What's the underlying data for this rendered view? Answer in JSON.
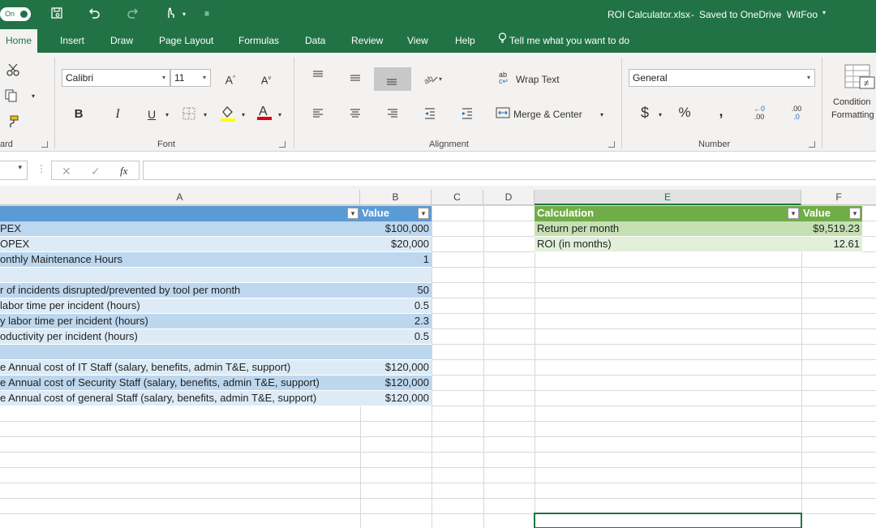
{
  "titlebar": {
    "autosave": "On",
    "document": "ROI Calculator.xlsx",
    "saved": "Saved to OneDrive",
    "account": "WitFoo"
  },
  "tabs": [
    "Home",
    "Insert",
    "Draw",
    "Page Layout",
    "Formulas",
    "Data",
    "Review",
    "View",
    "Help"
  ],
  "tellme": "Tell me what you want to do",
  "ribbon": {
    "groups": {
      "clipboard": "ard",
      "font": "Font",
      "alignment": "Alignment",
      "number": "Number"
    },
    "font_name": "Calibri",
    "font_size": "11",
    "bold": "B",
    "italic": "I",
    "underline": "U",
    "wrap_text": "Wrap Text",
    "merge_center": "Merge & Center",
    "number_format": "General",
    "currency": "$",
    "percent": "%",
    "comma": ",",
    "inc_decimal": ".00",
    "dec_decimal": ".0",
    "conditional_formatting": "Condition",
    "conditional_formatting_2": "Formatting"
  },
  "formula_bar": {
    "fx": "fx",
    "content": ""
  },
  "columns": [
    "A",
    "B",
    "C",
    "D",
    "E",
    "F"
  ],
  "table1": {
    "header_b": "Value",
    "rows": [
      {
        "a": "PEX",
        "b": "$100,000"
      },
      {
        "a": "OPEX",
        "b": "$20,000"
      },
      {
        "a": "onthly Maintenance Hours",
        "b": "1"
      },
      {
        "a": "",
        "b": ""
      },
      {
        "a": "r of incidents disrupted/prevented by tool per month",
        "b": "50"
      },
      {
        "a": "labor time per incident (hours)",
        "b": "0.5"
      },
      {
        "a": "y labor time per incident (hours)",
        "b": "2.3"
      },
      {
        "a": "oductivity per incident (hours)",
        "b": "0.5"
      },
      {
        "a": "",
        "b": ""
      },
      {
        "a": "e Annual cost of IT Staff (salary, benefits, admin T&E, support)",
        "b": "$120,000"
      },
      {
        "a": "e Annual cost of Security Staff (salary, benefits, admin T&E, support)",
        "b": "$120,000"
      },
      {
        "a": "e Annual cost of general Staff (salary, benefits, admin T&E, support)",
        "b": "$120,000"
      }
    ]
  },
  "table2": {
    "header_e": "Calculation",
    "header_f": "Value",
    "rows": [
      {
        "e": "Return per month",
        "f": "$9,519.23"
      },
      {
        "e": "ROI (in months)",
        "f": "12.61"
      }
    ]
  },
  "colors": {
    "excel_green": "#217346",
    "table1_header": "#5b9bd5",
    "table1_band": "#ddebf7",
    "table1_band2": "#bdd7ee",
    "table2_header": "#70ad47",
    "table2_band": "#c6e0b4",
    "table2_band2": "#e2efda"
  }
}
